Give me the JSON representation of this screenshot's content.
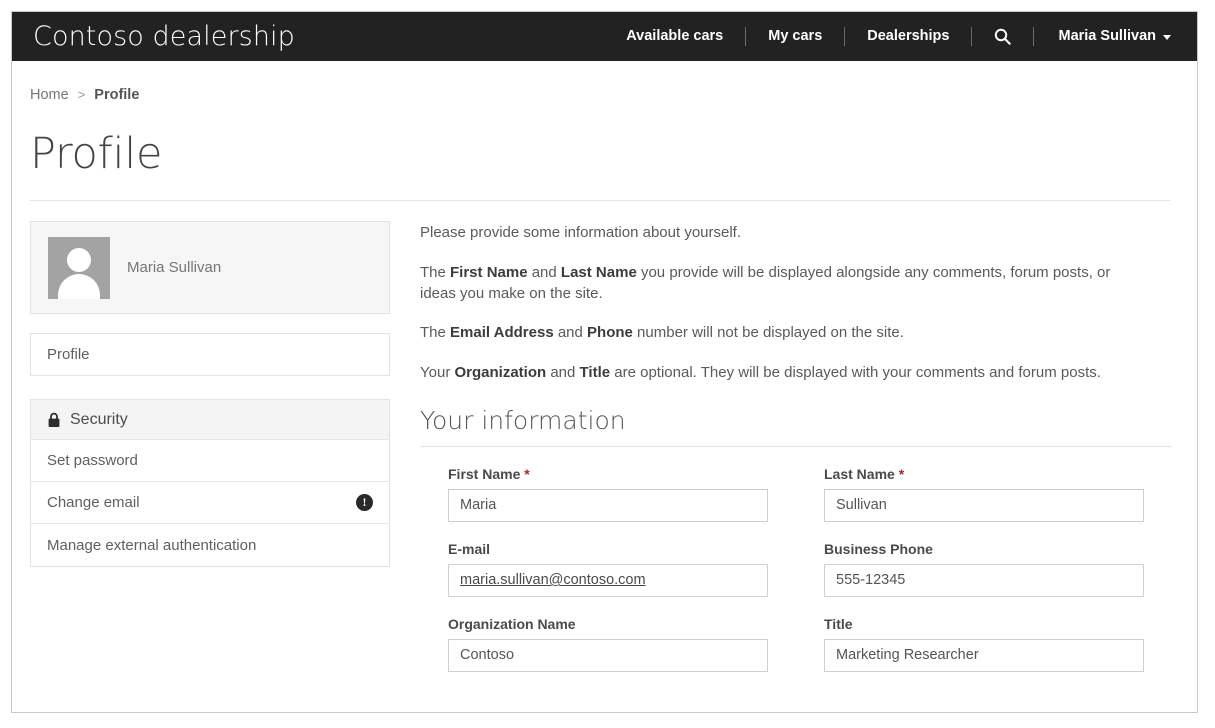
{
  "header": {
    "brand": "Contoso dealership",
    "nav": [
      {
        "label": "Available cars"
      },
      {
        "label": "My cars"
      },
      {
        "label": "Dealerships"
      }
    ],
    "search_icon": "search-icon",
    "user": {
      "name": "Maria Sullivan",
      "caret": "chevron-down-icon"
    }
  },
  "breadcrumb": {
    "home": "Home",
    "separator": ">",
    "current": "Profile"
  },
  "page": {
    "title": "Profile"
  },
  "sidebar": {
    "profile_card": {
      "avatar_icon": "user-avatar-placeholder",
      "name": "Maria Sullivan"
    },
    "nav_items": [
      {
        "label": "Profile"
      }
    ],
    "security": {
      "lock_icon": "lock-icon",
      "header": "Security",
      "items": [
        {
          "label": "Set password",
          "badge": ""
        },
        {
          "label": "Change email",
          "badge": "!"
        },
        {
          "label": "Manage external authentication",
          "badge": ""
        }
      ]
    }
  },
  "main": {
    "intro": {
      "p1": "Please provide some information about yourself.",
      "p2_a": "The ",
      "p2_b1": "First Name",
      "p2_c": " and ",
      "p2_b2": "Last Name",
      "p2_d": " you provide will be displayed alongside any comments, forum posts, or ideas you make on the site.",
      "p3_a": "The ",
      "p3_b1": "Email Address",
      "p3_c": " and ",
      "p3_b2": "Phone",
      "p3_d": " number will not be displayed on the site.",
      "p4_a": "Your ",
      "p4_b1": "Organization",
      "p4_c": " and ",
      "p4_b2": "Title",
      "p4_d": " are optional. They will be displayed with your comments and forum posts."
    },
    "section_title": "Your information",
    "fields": {
      "first_name": {
        "label": "First Name",
        "required": "*",
        "value": "Maria"
      },
      "last_name": {
        "label": "Last Name",
        "required": "*",
        "value": "Sullivan"
      },
      "email": {
        "label": "E-mail",
        "value": "maria.sullivan@contoso.com"
      },
      "business_phone": {
        "label": "Business Phone",
        "value": "555-12345"
      },
      "organization": {
        "label": "Organization Name",
        "value": "Contoso"
      },
      "title": {
        "label": "Title",
        "value": "Marketing Researcher"
      }
    }
  },
  "colors": {
    "navbar_bg": "#222222",
    "accent_required": "#a4262c",
    "card_bg": "#f6f6f6",
    "border": "#e2e2e2"
  }
}
